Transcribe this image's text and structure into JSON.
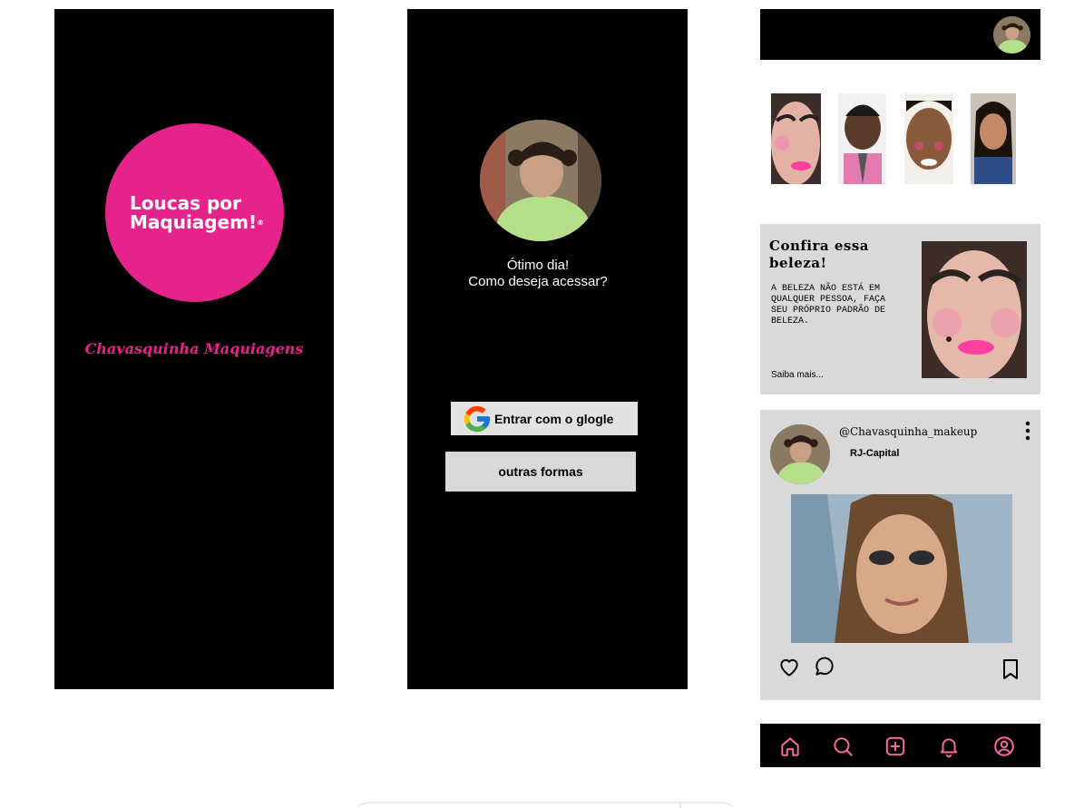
{
  "splash": {
    "logo_line1": "Loucas por",
    "logo_line2": "Maquiagem!",
    "logo_mark": "®",
    "brand": "Chavasquinha Maquiagens",
    "colors": {
      "accent": "#e6238b",
      "background": "#000000"
    }
  },
  "login": {
    "greeting_line1": "Ótimo dia!",
    "greeting_line2": "Como deseja acessar?",
    "google_button": "Entrar com o glogle",
    "google_icon": "google-g-icon",
    "other_button": "outras formas"
  },
  "feed": {
    "profile_icon": "profile-avatar",
    "stories": [
      "story-1",
      "story-2",
      "story-3",
      "story-4"
    ],
    "promo": {
      "title_line1": "Confira essa",
      "title_line2": "beleza!",
      "body": "A BELEZA NÃO ESTÁ EM QUALQUER PESSOA, FAÇA SEU PRÓPRIO PADRÃO DE BELEZA.",
      "more": "Saiba mais..."
    },
    "post": {
      "handle": "@Chavasquinha_makeup",
      "location": "RJ-Capital",
      "actions": [
        "heart-icon",
        "comment-icon",
        "bookmark-icon"
      ]
    },
    "nav": [
      "home-icon",
      "search-icon",
      "add-icon",
      "bell-icon",
      "profile-icon"
    ],
    "colors": {
      "card": "#d9d9d9",
      "bar": "#000000"
    }
  }
}
